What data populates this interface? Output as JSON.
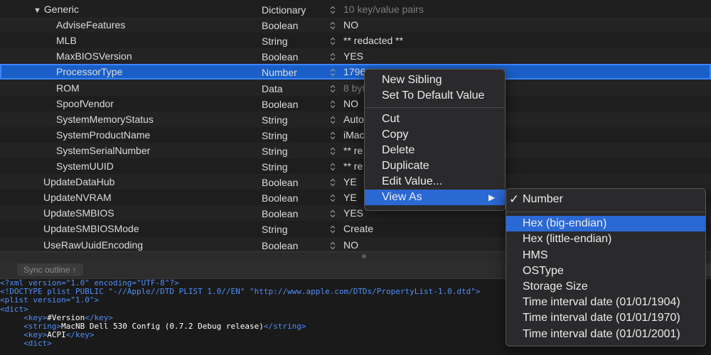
{
  "rows": [
    {
      "key": "Generic",
      "indent": "parent",
      "expanded": true,
      "type": "Dictionary",
      "value": "10 key/value pairs",
      "value_dim": true
    },
    {
      "key": "AdviseFeatures",
      "indent": "child",
      "type": "Boolean",
      "value": "NO"
    },
    {
      "key": "MLB",
      "indent": "child",
      "type": "String",
      "value": "** redacted **"
    },
    {
      "key": "MaxBIOSVersion",
      "indent": "child",
      "type": "Boolean",
      "value": "YES"
    },
    {
      "key": "ProcessorType",
      "indent": "child",
      "type": "Number",
      "value": "1796",
      "selected": true
    },
    {
      "key": "ROM",
      "indent": "child",
      "type": "Data",
      "value": "8 byt",
      "value_dim": true
    },
    {
      "key": "SpoofVendor",
      "indent": "child",
      "type": "Boolean",
      "value": "NO"
    },
    {
      "key": "SystemMemoryStatus",
      "indent": "child",
      "type": "String",
      "value": "Auto"
    },
    {
      "key": "SystemProductName",
      "indent": "child",
      "type": "String",
      "value": "iMac"
    },
    {
      "key": "SystemSerialNumber",
      "indent": "child",
      "type": "String",
      "value": "** re"
    },
    {
      "key": "SystemUUID",
      "indent": "child",
      "type": "String",
      "value": "** re"
    },
    {
      "key": "UpdateDataHub",
      "indent": "parent",
      "type": "Boolean",
      "value": "YE"
    },
    {
      "key": "UpdateNVRAM",
      "indent": "parent",
      "type": "Boolean",
      "value": "YE"
    },
    {
      "key": "UpdateSMBIOS",
      "indent": "parent",
      "type": "Boolean",
      "value": "YES"
    },
    {
      "key": "UpdateSMBIOSMode",
      "indent": "parent",
      "type": "String",
      "value": "Create"
    },
    {
      "key": "UseRawUuidEncoding",
      "indent": "parent",
      "type": "Boolean",
      "value": "NO"
    }
  ],
  "toolbar": {
    "sync_outline_label": "Sync outline ↑"
  },
  "xml_lines": [
    {
      "indent": "",
      "parts": [
        {
          "c": "tag",
          "t": "<?xml version=\"1.0\" encoding=\"UTF-8\"?>"
        }
      ]
    },
    {
      "indent": "",
      "parts": [
        {
          "c": "tag",
          "t": "<!DOCTYPE plist PUBLIC \"-//Apple//DTD PLIST 1.0//EN\" \"http://www.apple.com/DTDs/PropertyList-1.0.dtd\">"
        }
      ]
    },
    {
      "indent": "",
      "parts": [
        {
          "c": "tag",
          "t": "<plist version=\"1.0\">"
        }
      ]
    },
    {
      "indent": "",
      "parts": [
        {
          "c": "tag",
          "t": "<dict>"
        }
      ]
    },
    {
      "indent": "     ",
      "parts": [
        {
          "c": "tag",
          "t": "<key>"
        },
        {
          "c": "txt",
          "t": "#Version"
        },
        {
          "c": "tag",
          "t": "</key>"
        }
      ]
    },
    {
      "indent": "     ",
      "parts": [
        {
          "c": "tag",
          "t": "<string>"
        },
        {
          "c": "txt",
          "t": "MacNB Dell 530 Config (0.7.2 Debug release)"
        },
        {
          "c": "tag",
          "t": "</string>"
        }
      ]
    },
    {
      "indent": "     ",
      "parts": [
        {
          "c": "tag",
          "t": "<key>"
        },
        {
          "c": "txt",
          "t": "ACPI"
        },
        {
          "c": "tag",
          "t": "</key>"
        }
      ]
    },
    {
      "indent": "     ",
      "parts": [
        {
          "c": "tag",
          "t": "<dict>"
        }
      ]
    }
  ],
  "context_menu": {
    "items": [
      {
        "label": "New Sibling"
      },
      {
        "label": "Set To Default Value"
      },
      {
        "sep": true
      },
      {
        "label": "Cut"
      },
      {
        "label": "Copy"
      },
      {
        "label": "Delete"
      },
      {
        "label": "Duplicate"
      },
      {
        "label": "Edit Value..."
      },
      {
        "label": "View As",
        "submenu": true,
        "highlighted": true
      }
    ]
  },
  "view_as_submenu": {
    "items": [
      {
        "label": "Number",
        "checked": true
      },
      {
        "sep": true
      },
      {
        "label": "Hex (big-endian)",
        "highlighted": true
      },
      {
        "label": "Hex (little-endian)"
      },
      {
        "label": "HMS"
      },
      {
        "label": "OSType"
      },
      {
        "label": "Storage Size"
      },
      {
        "label": "Time interval date (01/01/1904)"
      },
      {
        "label": "Time interval date (01/01/1970)"
      },
      {
        "label": "Time interval date (01/01/2001)"
      }
    ]
  },
  "icons": {
    "disclosure": "disclosure-triangle-down-icon",
    "stepper": "up-down-stepper-icon",
    "submenu": "submenu-arrow-icon",
    "check": "checkmark-icon"
  },
  "colors": {
    "selection": "#1a5fc7",
    "menu_highlight": "#2a68d4",
    "xml_tag": "#4f8ef7",
    "background": "#1e1e1e"
  }
}
